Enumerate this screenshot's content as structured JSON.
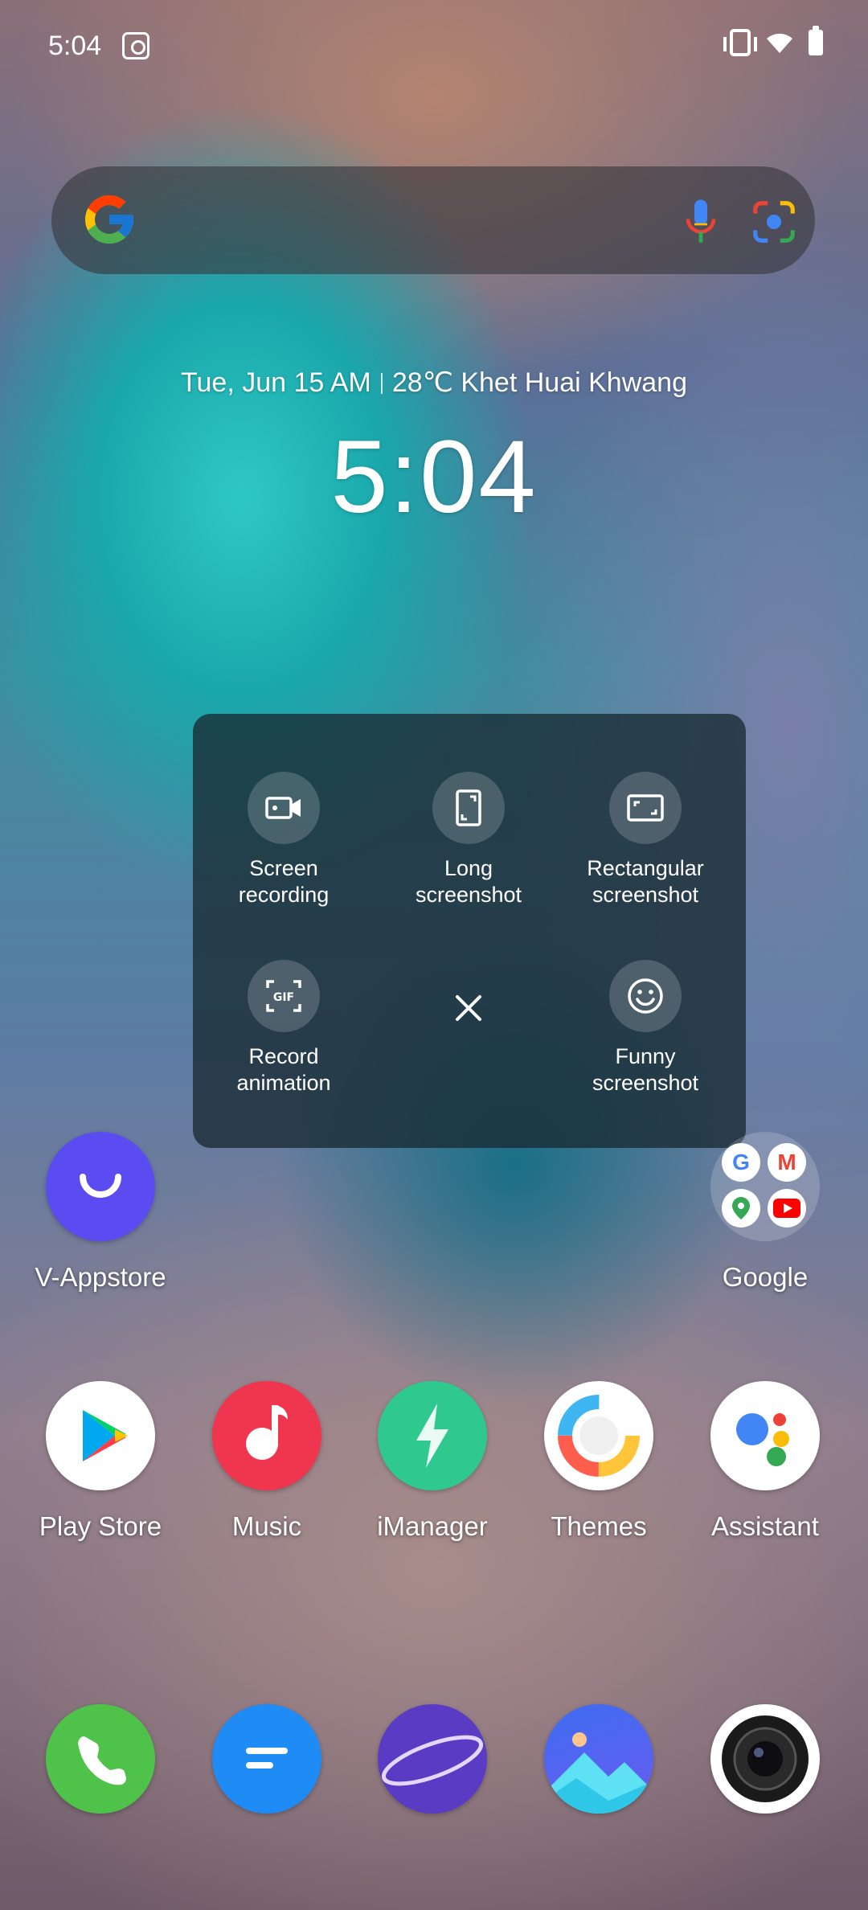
{
  "status_bar": {
    "time": "5:04"
  },
  "search": {
    "logo": "G"
  },
  "header": {
    "date": "Tue, Jun 15 AM",
    "temperature": "28℃",
    "location": "Khet Huai Khwang",
    "clock": "5:04"
  },
  "screenshot_menu": {
    "options": [
      {
        "label": "Screen\nrecording",
        "icon": "video-camera-icon"
      },
      {
        "label": "Long\nscreenshot",
        "icon": "phone-outline-icon"
      },
      {
        "label": "Rectangular\nscreenshot",
        "icon": "crop-frame-icon"
      },
      {
        "label": "Record\nanimation",
        "icon": "gif-icon"
      },
      {
        "label": "Funny\nscreenshot",
        "icon": "smiley-icon"
      }
    ],
    "close_icon": "close-icon"
  },
  "apps": {
    "row1": [
      {
        "name": "V-Appstore"
      },
      {
        "name": "Google"
      }
    ],
    "row2": [
      {
        "name": "Play Store"
      },
      {
        "name": "Music"
      },
      {
        "name": "iManager"
      },
      {
        "name": "Themes"
      },
      {
        "name": "Assistant"
      }
    ]
  },
  "dock": [
    {
      "icon": "phone-icon"
    },
    {
      "icon": "messages-icon"
    },
    {
      "icon": "browser-icon"
    },
    {
      "icon": "gallery-icon"
    },
    {
      "icon": "camera-icon"
    }
  ],
  "colors": {
    "panel_bg": "#182a32",
    "appstore": "#5b4cf2",
    "music": "#f0364e",
    "imanager": "#2fc98f",
    "phone": "#4fc24a",
    "messages": "#1f8bf5",
    "browser": "#5a3bc4"
  }
}
